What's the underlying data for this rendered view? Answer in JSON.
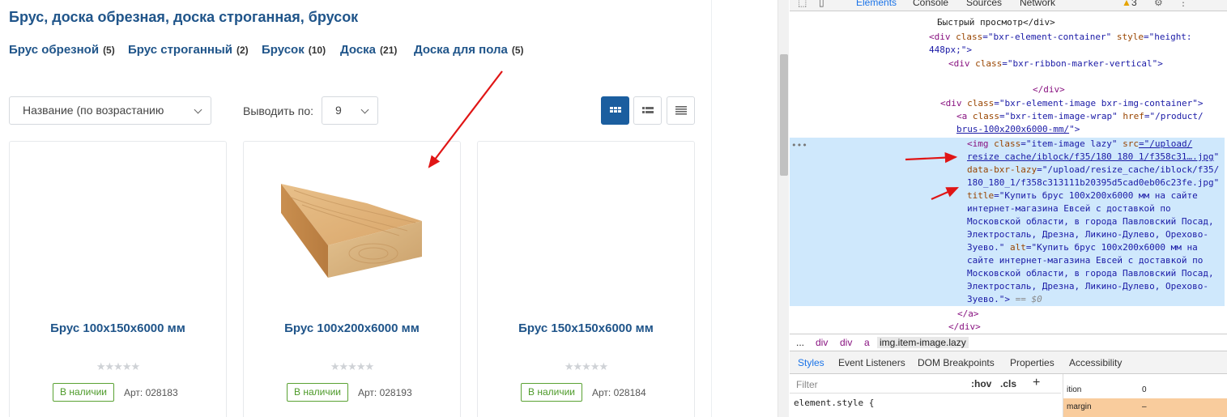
{
  "page": {
    "title": "Брус, доска обрезная, доска строганная, брусок",
    "categories": [
      {
        "label": "Брус обрезной",
        "count": "(5)"
      },
      {
        "label": "Брус строганный",
        "count": "(2)"
      },
      {
        "label": "Брусок",
        "count": "(10)"
      },
      {
        "label": "Доска",
        "count": "(21)"
      },
      {
        "label": "Доска для пола",
        "count": "(5)"
      }
    ],
    "sort_value": "Название (по возрастанию",
    "perpage_label": "Выводить по:",
    "perpage_value": "9",
    "products": [
      {
        "name": "Брус 100x150x6000 мм",
        "stock": "В наличии",
        "art": "Арт: 028183",
        "stars": "★★★★★"
      },
      {
        "name": "Брус 100x200x6000 мм",
        "stock": "В наличии",
        "art": "Арт: 028193",
        "stars": "★★★★★"
      },
      {
        "name": "Брус 150x150x6000 мм",
        "stock": "В наличии",
        "art": "Арт: 028184",
        "stars": "★★★★★"
      }
    ]
  },
  "devtools": {
    "tabs": [
      "Elements",
      "Console",
      "Sources",
      "Network"
    ],
    "warn_count": "3",
    "lines": {
      "l0": "Быстрый просмотр</div>",
      "l1a": "<div ",
      "l1b": "class",
      "l1c": "=\"bxr-element-container\" ",
      "l1d": "style",
      "l1e": "=\"height:",
      "l2": "448px;\">",
      "l3a": "<div ",
      "l3b": "class",
      "l3c": "=\"bxr-ribbon-marker-vertical\">",
      "l4": "</div>",
      "l5a": "<div ",
      "l5b": "class",
      "l5c": "=\"bxr-element-image bxr-img-container\">",
      "l6a": "<a ",
      "l6b": "class",
      "l6c": "=\"bxr-item-image-wrap\" ",
      "l6d": "href",
      "l6e": "=\"/product/",
      "l7": "brus-100x200x6000-mm/",
      "l7b": "\">",
      "l8a": "<img ",
      "l8b": "class",
      "l8c": "=\"item-image lazy\" ",
      "l8d": "src",
      "l8e": "=\"/upload/",
      "l9": "resize cache/iblock/f35/180 180 1/f358c31….jpg",
      "l9b": "\"",
      "l10a": "data-bxr-lazy",
      "l10b": "=\"/upload/resize_cache/iblock/f35/",
      "l11": "180_180_1/f358c313111b20395d5cad0eb06c23fe.jpg\"",
      "l12a": "title",
      "l12b": "=\"Купить брус 100x200x6000 мм на сайте",
      "l13": "интернет-магазина Евсей с доставкой по",
      "l14": "Московской области, в города Павловский Посад,",
      "l15": "Электросталь, Дрезна, Ликино-Дулево, Орехово-",
      "l16a": "Зуево.\" ",
      "l16b": "alt",
      "l16c": "=\"Купить брус 100x200x6000 мм на",
      "l17": "сайте интернет-магазина Евсей с доставкой по",
      "l18": "Московской области, в города Павловский Посад,",
      "l19": "Электросталь, Дрезна, Ликино-Дулево, Орехово-",
      "l20a": "Зуево.\">",
      "l20b": " == $0",
      "l21": "</a>",
      "l22": "</div>"
    },
    "breadcrumb": [
      "...",
      "div",
      "div",
      "a",
      "img.item-image.lazy"
    ],
    "style_tabs": [
      "Styles",
      "Event Listeners",
      "DOM Breakpoints",
      "Properties",
      "Accessibility"
    ],
    "filter_placeholder": "Filter",
    "hov": ":hov",
    "cls": ".cls",
    "element_style": "element.style {",
    "box_position": "ition",
    "box_position_val": "0",
    "box_margin": "margin",
    "box_margin_val": "–"
  },
  "colors": {
    "accent": "#1b5e9f",
    "link": "#20558a",
    "stock": "#4d9a29",
    "arrow": "#e01515"
  }
}
